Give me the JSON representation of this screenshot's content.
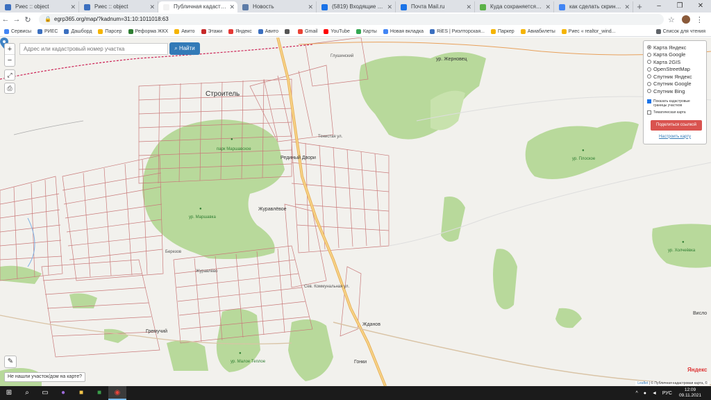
{
  "tabs": [
    {
      "title": "Риес :: object",
      "fav": "#3b6fbf",
      "active": false
    },
    {
      "title": "Риес :: object",
      "fav": "#3b6fbf",
      "active": false
    },
    {
      "title": "Публичная кадастровая к",
      "fav": "#f2f2f2",
      "active": true
    },
    {
      "title": "Новость",
      "fav": "#5d7ca8",
      "active": false
    },
    {
      "title": "(5819) Входящие - Почта",
      "fav": "#1a73e8",
      "active": false
    },
    {
      "title": "Почта Mail.ru",
      "fav": "#1a73e8",
      "active": false
    },
    {
      "title": "Куда сохраняется скрин",
      "fav": "#5bb248",
      "active": false
    },
    {
      "title": "как сделать скрин экрана",
      "fav": "#4285f4",
      "active": false
    }
  ],
  "url": "egrp365.org/map/?kadnum=31:10:1011018:63",
  "bookmarks": [
    {
      "label": "Сервисы",
      "color": "#4285f4"
    },
    {
      "label": "РИЕС",
      "color": "#3b6fbf"
    },
    {
      "label": "Дашборд",
      "color": "#3b6fbf"
    },
    {
      "label": "Парсер",
      "color": "#f5b400"
    },
    {
      "label": "Реформа ЖКХ",
      "color": "#2e7d32"
    },
    {
      "label": "Авито",
      "color": "#f5b400"
    },
    {
      "label": "Этажи",
      "color": "#c62828"
    },
    {
      "label": "Яндекс",
      "color": "#e53935"
    },
    {
      "label": "Авито",
      "color": "#3b6fbf"
    },
    {
      "label": "",
      "color": "#555555"
    },
    {
      "label": "Gmail",
      "color": "#ea4335"
    },
    {
      "label": "YouTube",
      "color": "#ff0000"
    },
    {
      "label": "Карты",
      "color": "#34a853"
    },
    {
      "label": "Новая вкладка",
      "color": "#4285f4"
    },
    {
      "label": "RiES | Риэлторская...",
      "color": "#3b6fbf"
    },
    {
      "label": "Паркер",
      "color": "#f5b400"
    },
    {
      "label": "Авиабилеты",
      "color": "#f5b400"
    },
    {
      "label": "Риес « realtor_wind...",
      "color": "#f5b400"
    }
  ],
  "reading_list": "Список для чтения",
  "search": {
    "placeholder": "Адрес или кадастровый номер участка",
    "button": "Найти"
  },
  "layers": {
    "options": [
      {
        "label": "Карта Яндекс",
        "selected": true
      },
      {
        "label": "Карта Google",
        "selected": false
      },
      {
        "label": "Карта 2GIS",
        "selected": false
      },
      {
        "label": "OpenStreetMap",
        "selected": false
      },
      {
        "label": "Спутник Яндекс",
        "selected": false
      },
      {
        "label": "Спутник Google",
        "selected": false
      },
      {
        "label": "Спутник Bing",
        "selected": false
      }
    ],
    "show_cadastral": "Показать кадастровые границы участков",
    "show_cadastral_checked": true,
    "thematic": "Тематическая карта",
    "thematic_checked": false,
    "share": "Поделиться ссылкой",
    "setup": "Настроить карту"
  },
  "not_found": "Не нашли участок/дом на карте?",
  "yandex": "Яндекс",
  "attribution": {
    "leaflet": "Leaflet",
    "rest": " | © Публичная кадастровая карта, ©"
  },
  "map_labels": {
    "stroitel": "Строитель",
    "zhernovets": "ур. Жерновец",
    "plosky": "ур. Плоское",
    "marshavka": "ур. Маршавка",
    "park": "парк Маршавское",
    "zhuravlevo": "Журавлёвое",
    "zhuravlevo2": "Журавлёво",
    "redinyi": "Рединый Двори",
    "kholcheevka": "ур. Холчеёвка",
    "gremuchiy": "Гремучий",
    "maloe": "ур. Малое Теплое",
    "zhdanov": "Жданов",
    "gonki": "Гонки",
    "vislo": "Висло",
    "berezov": "Березов",
    "pruhovka": "Глушинский",
    "tenistaya": "Тенистая ул.",
    "sevkom": "Сев. Коммунальная ул."
  },
  "taskbar": {
    "lang": "РУС",
    "time": "12:09",
    "date": "09.11.2021"
  }
}
